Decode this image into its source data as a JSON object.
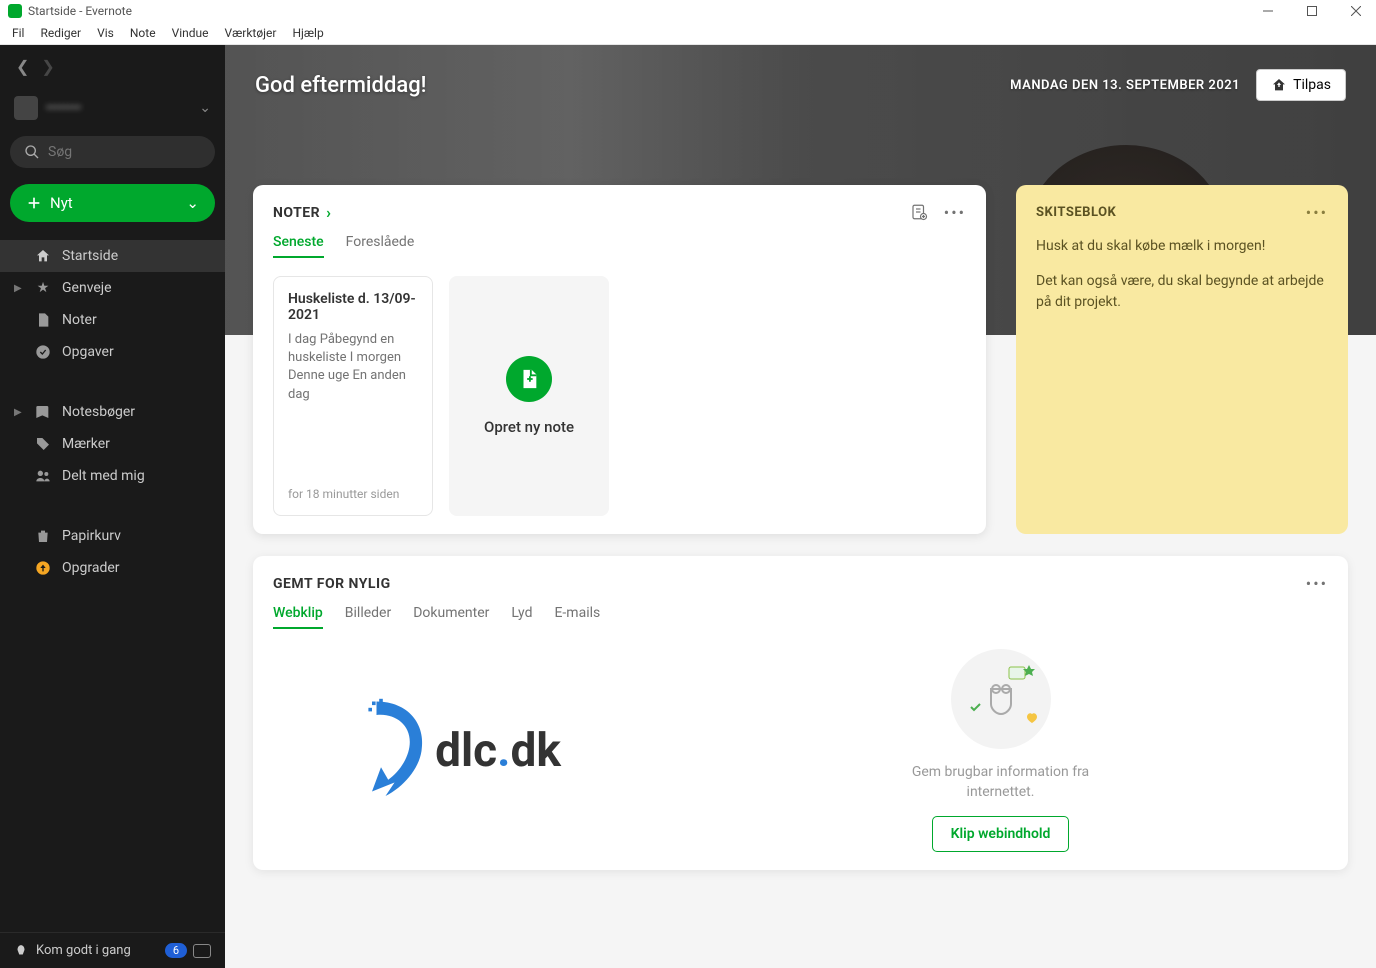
{
  "window": {
    "title": "Startside - Evernote"
  },
  "menu": {
    "items": [
      "Fil",
      "Rediger",
      "Vis",
      "Note",
      "Vindue",
      "Værktøjer",
      "Hjælp"
    ]
  },
  "sidebar": {
    "username": "••••••••",
    "search_placeholder": "Søg",
    "new_label": "Nyt",
    "items": [
      {
        "label": "Startside",
        "icon": "home"
      },
      {
        "label": "Genveje",
        "icon": "star",
        "expandable": true
      },
      {
        "label": "Noter",
        "icon": "note"
      },
      {
        "label": "Opgaver",
        "icon": "check"
      },
      {
        "label": "Notesbøger",
        "icon": "book",
        "expandable": true
      },
      {
        "label": "Mærker",
        "icon": "tag"
      },
      {
        "label": "Delt med mig",
        "icon": "people"
      },
      {
        "label": "Papirkurv",
        "icon": "trash"
      },
      {
        "label": "Opgrader",
        "icon": "upgrade"
      }
    ],
    "footer_label": "Kom godt i gang",
    "footer_badge": "6"
  },
  "hero": {
    "greeting": "God eftermiddag!",
    "date": "MANDAG DEN 13. SEPTEMBER 2021",
    "customize_label": "Tilpas"
  },
  "notes_card": {
    "title": "NOTER",
    "tabs": [
      "Seneste",
      "Foreslåede"
    ],
    "active_tab": 0,
    "note": {
      "title": "Huskeliste d. 13/09-2021",
      "preview": "I dag Påbegynd en huskeliste I morgen Denne uge En anden dag",
      "time": "for 18 minutter siden"
    },
    "create_label": "Opret ny note"
  },
  "sketch": {
    "title": "SKITSEBLOK",
    "line1": "Husk at du skal købe mælk i morgen!",
    "line2": "Det kan også være, du skal begynde at arbejde på dit projekt."
  },
  "recent": {
    "title": "GEMT FOR NYLIG",
    "tabs": [
      "Webklip",
      "Billeder",
      "Dokumenter",
      "Lyd",
      "E-mails"
    ],
    "active_tab": 0,
    "empty_text": "Gem brugbar information fra internettet.",
    "clip_label": "Klip webindhold",
    "watermark_a": "dlc",
    "watermark_b": ".",
    "watermark_c": "dk"
  }
}
